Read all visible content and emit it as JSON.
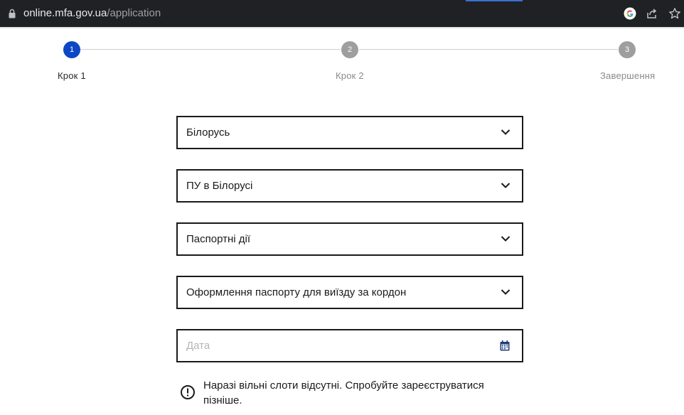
{
  "browser": {
    "url_host": "online.mfa.gov.ua",
    "url_path": "/application",
    "icons": [
      "lock-icon",
      "google-icon",
      "share-icon",
      "star-icon"
    ]
  },
  "stepper": {
    "steps": [
      {
        "number": "1",
        "label": "Крок 1",
        "state": "active"
      },
      {
        "number": "2",
        "label": "Крок 2",
        "state": "inactive"
      },
      {
        "number": "3",
        "label": "Завершення",
        "state": "inactive"
      }
    ],
    "active_color": "#0d47c4",
    "inactive_color": "#9e9e9e"
  },
  "form": {
    "country_select": {
      "value": "Білорусь"
    },
    "office_select": {
      "value": "ПУ в Білорусі"
    },
    "service_category_select": {
      "value": "Паспортні дії"
    },
    "service_select": {
      "value": "Оформлення паспорту для виїзду за кордон"
    },
    "date_input": {
      "placeholder": "Дата"
    }
  },
  "notice": {
    "icon": "exclamation-circle-icon",
    "text": "Наразі вільні слоти відсутні. Спробуйте зареєструватися пізніше."
  }
}
